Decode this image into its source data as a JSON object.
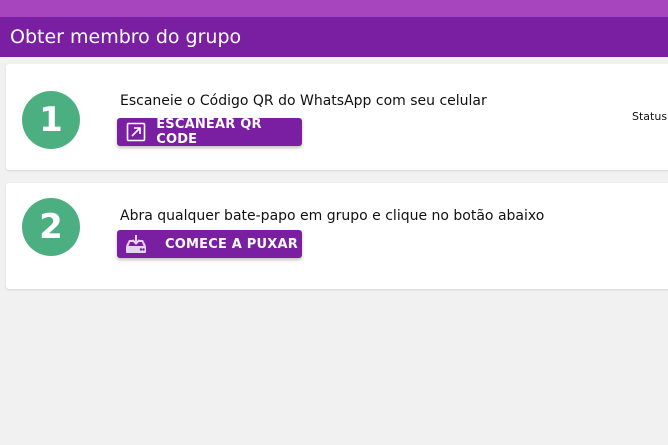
{
  "header": {
    "title": "Obter membro do grupo"
  },
  "steps": [
    {
      "number": "1",
      "text": "Escaneie o Código QR do WhatsApp com seu celular",
      "button_label": "ESCANEAR QR CODE",
      "button_icon": "open-external-icon",
      "status_label": "Status"
    },
    {
      "number": "2",
      "text": "Abra qualquer bate-papo em grupo e clique no botão abaixo",
      "button_label": "COMECE A PUXAR",
      "button_icon": "download-tray-icon"
    }
  ],
  "colors": {
    "top_strip": "#a645bd",
    "header": "#7b1fa2",
    "button": "#7b1fa2",
    "step_circle": "#4caf82",
    "background": "#f1f1f1"
  }
}
